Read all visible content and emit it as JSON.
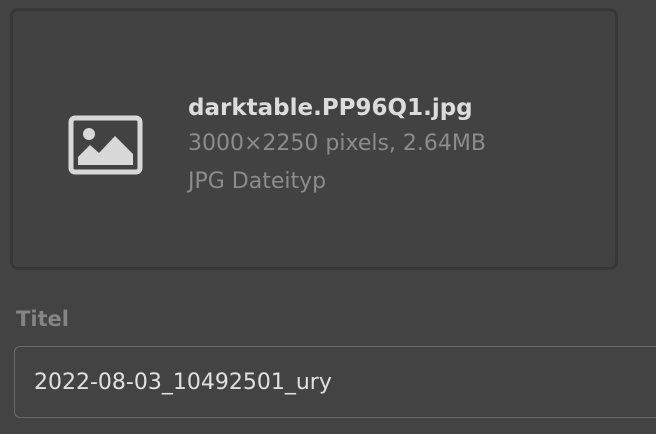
{
  "file": {
    "name": "darktable.PP96Q1.jpg",
    "dimensions_size": "3000×2250 pixels, 2.64MB",
    "type": "JPG Dateityp",
    "icon": "image-icon"
  },
  "title_field": {
    "label": "Titel",
    "value": "2022-08-03_10492501_ury"
  },
  "colors": {
    "background": "#434343",
    "card_border": "#373737",
    "icon": "#d8d8d8"
  }
}
